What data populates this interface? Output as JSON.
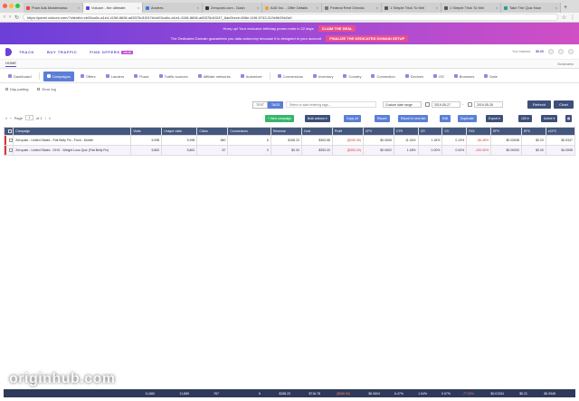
{
  "browser": {
    "tabs": [
      {
        "label": "Push Ads Masterclass",
        "active": false
      },
      {
        "label": "Voluum - the ultimate",
        "active": true
      },
      {
        "label": "Anstres",
        "active": false
      },
      {
        "label": "Zeropark.com - Dash",
        "active": false
      },
      {
        "label": "A4D Inc. - Offer Details",
        "active": false
      },
      {
        "label": "Federal Rent Checks",
        "active": false
      },
      {
        "label": "1 Simple Trick To Mel",
        "active": false
      },
      {
        "label": "1 Simple Trick To Mel",
        "active": false
      },
      {
        "label": "Take The Quiz Now",
        "active": false
      }
    ],
    "url": "https://panel.voluum.com/?clientId=cb03ca0c-a1e4-4198-8696-a65376d1f247#/cb03ca0c-a1e4-4198-8696-a65376d1f247_6ac0bcce-696e-41f6-9743-313e5b39e2a0"
  },
  "promo": {
    "line1": "Hurry up! Your exclusive birthday promo ends in 22 days",
    "button1": "CLAIM THE DEAL",
    "line2": "The Dedicated Domain guarantees you data autonomy because it is designed to your account",
    "button2": "FINALIZE THE DEDICATED DOMAIN SETUP"
  },
  "header": {
    "nav": [
      "TRACK",
      "BUY TRAFFIC",
      "FIND OFFERS"
    ],
    "beta": "NEW",
    "balance_label": "Your balance:",
    "balance": "$0.00"
  },
  "subheader": {
    "home": "HOME",
    "bookmarks": "Bookmarks"
  },
  "reports": {
    "tabs": [
      "Dashboard",
      "Campaigns",
      "Offers",
      "Landers",
      "Flows",
      "Traffic sources",
      "Affiliate networks",
      "Automizer",
      "Conversions",
      "Inventory",
      "Country",
      "Connection",
      "Devices",
      "OS",
      "Browsers",
      "Date"
    ]
  },
  "subbar": {
    "day_parting": "Day parting",
    "error_log": "Error log"
  },
  "filters": {
    "text_label": "TEXT",
    "tags_label": "TAGS",
    "search_placeholder": "Select or start entering tags...",
    "range": "Custom date range",
    "date_from": "2019-05-27",
    "date_to": "2019-05-28",
    "refresh": "Refresh",
    "chart": "Chart"
  },
  "pagination": {
    "page_label": "Page",
    "page": "1",
    "of_label": "of 1"
  },
  "actions": {
    "new_campaign": "New campaign",
    "bulk_actions": "Bulk actions",
    "copy_url": "Copy url",
    "report": "Report",
    "report_new_tab": "Report in new tab",
    "edit": "Edit",
    "duplicate": "Duplicate",
    "export": "Export",
    "per_page": "100",
    "status": "Active"
  },
  "table": {
    "headers": [
      "Campaign",
      "Visits",
      "Unique visits",
      "Clicks",
      "Conversions",
      "Revenue",
      "Cost",
      "Profit",
      "CPV",
      "CTR",
      "CR",
      "CV",
      "ROI",
      "EPV",
      "EPC",
      "eCPC"
    ],
    "rows": [
      [
        "Zeropark - United States - Flat Belly Fix - Push - Mobile",
        "5,998",
        "5,998",
        "680",
        "6",
        "$158.23",
        "$363.58",
        "($205.35)",
        "$0.0606",
        "11.34%",
        "1.18%",
        "0.13%",
        "-56.48%",
        "$0.02638",
        "$0.23",
        "$0.5347"
      ],
      [
        "Zeropark - United States - DHG - Weight Loss Quiz (Flat Belly Fix)",
        "5,862",
        "5,861",
        "87",
        "0",
        "$0.00",
        "$353.20",
        "($353.20)",
        "$0.0602",
        "1.48%",
        "0.00%",
        "0.00%",
        "-100.00%",
        "$0.00000",
        "$0.00",
        "$4.0598"
      ]
    ]
  },
  "totals": [
    "",
    "11,860",
    "11,859",
    "767",
    "6",
    "$158.23",
    "$716.78",
    "($558.55)",
    "$0.0604",
    "6.47%",
    "1.04%",
    "0.07%",
    "-77.92%",
    "$0.01334",
    "$0.21",
    "$0.9345"
  ],
  "watermark": "originhub.com",
  "colors": {
    "accent": "#5b7fd6",
    "header": "#44577d",
    "navy": "#3d4f7a",
    "green": "#35b66b",
    "negative": "#d03a3a",
    "promo_start": "#6b3fd8",
    "promo_end": "#d04fc4"
  }
}
